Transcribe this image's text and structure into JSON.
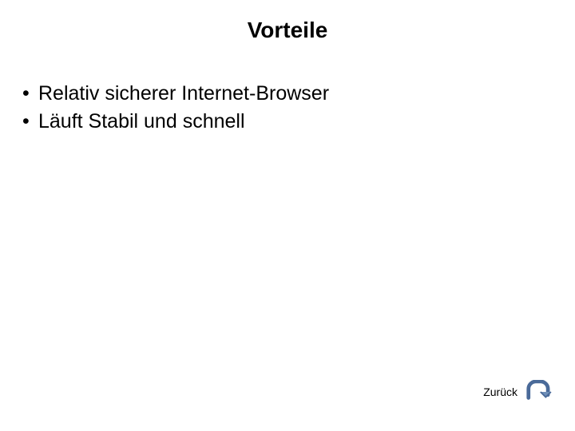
{
  "slide": {
    "title": "Vorteile",
    "bullets": [
      "Relativ sicherer Internet-Browser",
      "Läuft Stabil und schnell"
    ]
  },
  "nav": {
    "back_label": "Zurück",
    "icon_name": "u-turn-arrow-icon",
    "icon_stroke": "#4a6a99",
    "icon_fill": "#6f8fb8"
  }
}
